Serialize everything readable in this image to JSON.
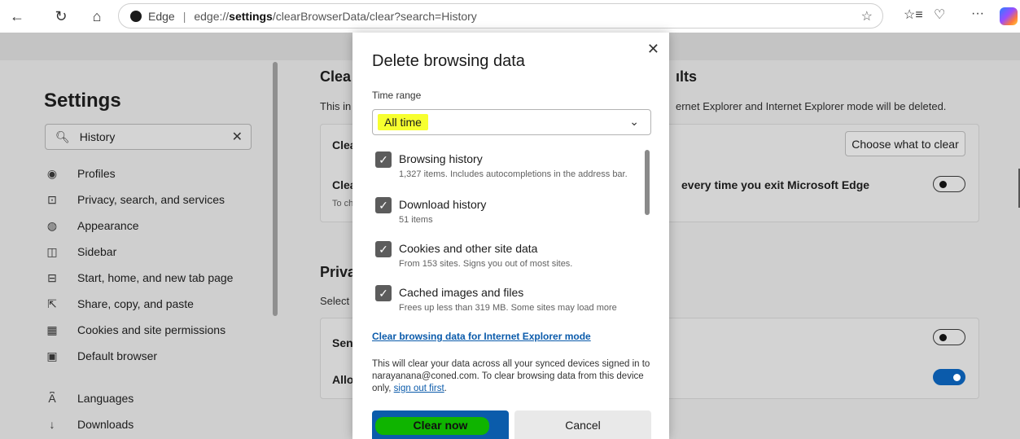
{
  "browser": {
    "site_label": "Edge",
    "url_prefix": "edge://",
    "url_bold": "settings",
    "url_suffix": "/clearBrowserData/clear?search=History",
    "icons": [
      "back-icon",
      "refresh-icon",
      "home-icon",
      "favorite-star-icon",
      "favorites-list-icon",
      "browser-essentials-icon",
      "more-icon",
      "copilot-icon"
    ]
  },
  "sidebar": {
    "title": "Settings",
    "search_value": "History",
    "items": [
      {
        "label": "Profiles",
        "icon": "profile-icon"
      },
      {
        "label": "Privacy, search, and services",
        "icon": "lock-icon"
      },
      {
        "label": "Appearance",
        "icon": "palette-icon"
      },
      {
        "label": "Sidebar",
        "icon": "sidebar-icon"
      },
      {
        "label": "Start, home, and new tab page",
        "icon": "home-page-icon"
      },
      {
        "label": "Share, copy, and paste",
        "icon": "share-icon"
      },
      {
        "label": "Cookies and site permissions",
        "icon": "cookie-permissions-icon"
      },
      {
        "label": "Default browser",
        "icon": "default-browser-icon"
      },
      {
        "label": "Languages",
        "icon": "languages-icon"
      },
      {
        "label": "Downloads",
        "icon": "download-icon"
      }
    ]
  },
  "main": {
    "section1_heading_left": "Clea",
    "section1_heading_right": "ılts",
    "section1_desc_left": "This in",
    "section1_desc_right": "ernet Explorer and Internet Explorer mode will be deleted.",
    "row1_left": "Clea",
    "choose_button": "Choose what to clear",
    "row2_left": "Clea",
    "row2_sub": "To ch",
    "row2_right": "every time you exit Microsoft Edge",
    "section2_heading": "Priva",
    "section2_desc": "Select",
    "row3_left": "Sen",
    "row4_left": "Allo"
  },
  "dialog": {
    "title": "Delete browsing data",
    "time_range_label": "Time range",
    "time_range_value": "All time",
    "items": [
      {
        "title": "Browsing history",
        "desc": "1,327 items. Includes autocompletions in the address bar.",
        "checked": true
      },
      {
        "title": "Download history",
        "desc": "51 items",
        "checked": true
      },
      {
        "title": "Cookies and other site data",
        "desc": "From 153 sites. Signs you out of most sites.",
        "checked": true
      },
      {
        "title": "Cached images and files",
        "desc": "Frees up less than 319 MB. Some sites may load more",
        "checked": true
      }
    ],
    "ie_link": "Clear browsing data for Internet Explorer mode",
    "note_text": "This will clear your data across all your synced devices signed in to narayanana@coned.com. To clear browsing data from this device only,",
    "note_link": "sign out first",
    "note_end": ".",
    "clear_button": "Clear now",
    "cancel_button": "Cancel"
  },
  "colors": {
    "accent": "#0b5cab",
    "highlight_yellow": "#f7ff2f",
    "highlight_green": "#0fb400"
  }
}
